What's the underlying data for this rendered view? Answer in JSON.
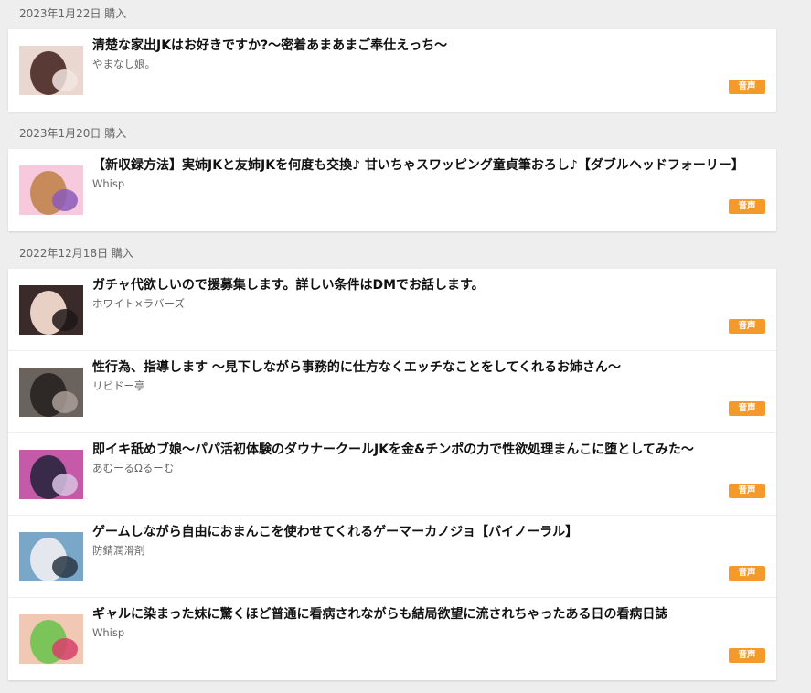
{
  "badge_label": "音声",
  "groups": [
    {
      "date": "2023年1月22日 購入",
      "items": [
        {
          "title": "清楚な家出JKはお好きですか?〜密着あまあまご奉仕えっち〜",
          "circle": "やまなし娘。",
          "thumb_colors": [
            "#e9d7d0",
            "#5a3a34",
            "#f2e5e0"
          ]
        }
      ]
    },
    {
      "date": "2023年1月20日 購入",
      "items": [
        {
          "title": "【新収録方法】実姉JKと友姉JKを何度も交換♪ 甘いちゃスワッピング童貞筆おろし♪【ダブルヘッドフォーリー】",
          "circle": "Whisp",
          "thumb_colors": [
            "#f6c9dc",
            "#c78a5a",
            "#8a5ab8"
          ]
        }
      ]
    },
    {
      "date": "2022年12月18日 購入",
      "items": [
        {
          "title": "ガチャ代欲しいので援募集します。詳しい条件はDMでお話します。",
          "circle": "ホワイト×ラバーズ",
          "thumb_colors": [
            "#3b2a2a",
            "#e8d0c4",
            "#1f1717"
          ]
        },
        {
          "title": "性行為、指導します 〜見下しながら事務的に仕方なくエッチなことをしてくれるお姉さん〜",
          "circle": "リビドー亭",
          "thumb_colors": [
            "#6a625c",
            "#2e2826",
            "#a89e96"
          ]
        },
        {
          "title": "即イキ舐めブ娘〜パパ活初体験のダウナークールJKを金&チンポの力で性欲処理まんこに堕としてみた〜",
          "circle": "あむーるΩるーむ",
          "thumb_colors": [
            "#c45aa8",
            "#3a2a4a",
            "#d8c2e0"
          ]
        },
        {
          "title": "ゲームしながら自由におまんこを使わせてくれるゲーマーカノジョ【バイノーラル】",
          "circle": "防錆潤滑剤",
          "thumb_colors": [
            "#7aa6c8",
            "#e4e8ee",
            "#2a3644"
          ]
        },
        {
          "title": "ギャルに染まった妹に驚くほど普通に看病されながらも結局欲望に流されちゃったある日の看病日誌",
          "circle": "Whisp",
          "thumb_colors": [
            "#f0c8b4",
            "#7ac45a",
            "#d8406a"
          ]
        }
      ]
    }
  ]
}
